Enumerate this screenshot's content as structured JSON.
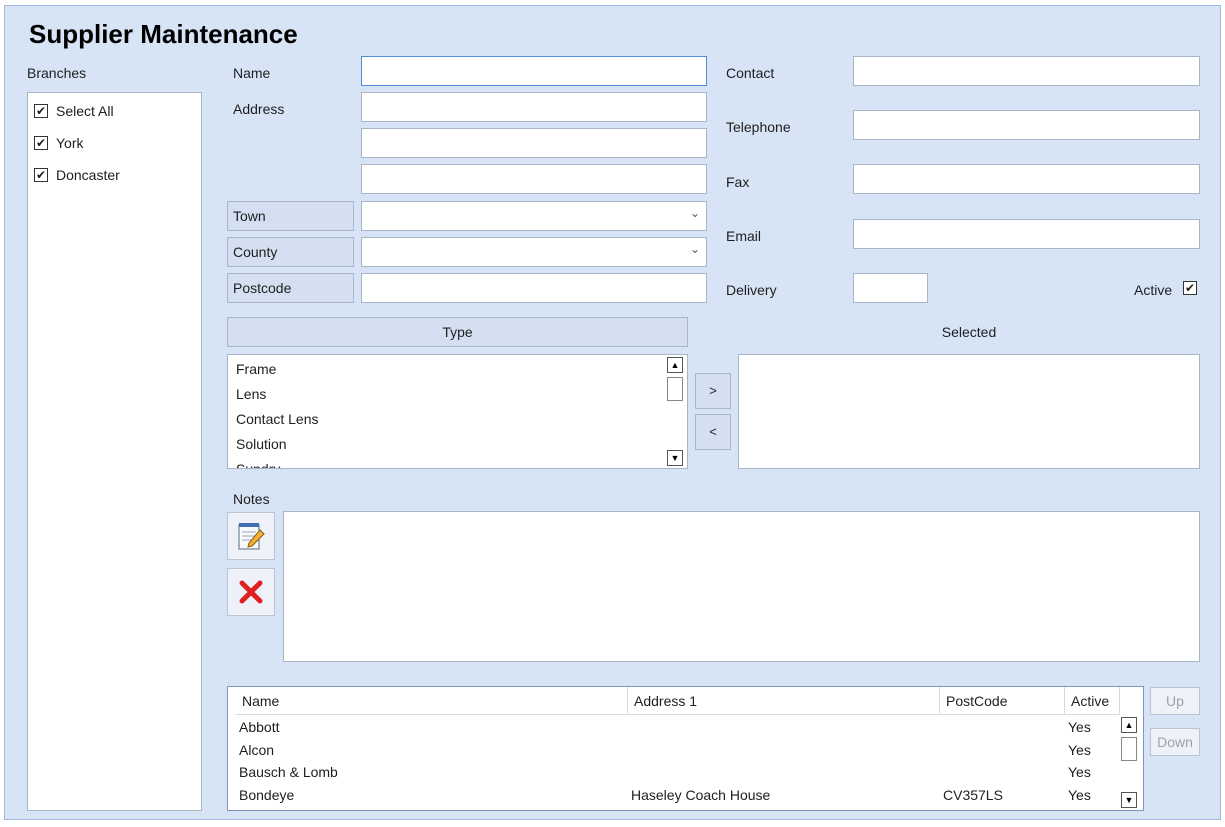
{
  "window": {
    "title": "Supplier Maintenance"
  },
  "branches": {
    "label": "Branches",
    "items": [
      {
        "label": "Select All",
        "checked": true
      },
      {
        "label": "York",
        "checked": true
      },
      {
        "label": "Doncaster",
        "checked": true
      }
    ]
  },
  "form": {
    "name_label": "Name",
    "name_value": "",
    "address_label": "Address",
    "address_lines": [
      "",
      "",
      ""
    ],
    "town_label": "Town",
    "town_value": "",
    "county_label": "County",
    "county_value": "",
    "postcode_label": "Postcode",
    "postcode_value": "",
    "contact_label": "Contact",
    "contact_value": "",
    "telephone_label": "Telephone",
    "telephone_value": "",
    "fax_label": "Fax",
    "fax_value": "",
    "email_label": "Email",
    "email_value": "",
    "delivery_label": "Delivery",
    "delivery_value": "",
    "active_label": "Active",
    "active_checked": true
  },
  "type_list": {
    "header": "Type",
    "items": [
      "Frame",
      "Lens",
      "Contact Lens",
      "Solution",
      "Sundry"
    ]
  },
  "selected_list": {
    "header": "Selected",
    "items": []
  },
  "move_buttons": {
    "add": ">",
    "remove": "<"
  },
  "notes": {
    "label": "Notes",
    "value": "",
    "edit_icon": "notepad-edit-icon",
    "delete_icon": "red-x-delete-icon"
  },
  "grid": {
    "columns": [
      "Name",
      "Address 1",
      "PostCode",
      "Active"
    ],
    "rows": [
      {
        "name": "Abbott",
        "address1": "",
        "postcode": "",
        "active": "Yes"
      },
      {
        "name": "Alcon",
        "address1": "",
        "postcode": "",
        "active": "Yes"
      },
      {
        "name": "Bausch & Lomb",
        "address1": "",
        "postcode": "",
        "active": "Yes"
      },
      {
        "name": "Bondeye",
        "address1": "Haseley Coach House",
        "postcode": "CV357LS",
        "active": "Yes"
      }
    ]
  },
  "side_buttons": {
    "up": "Up",
    "down": "Down"
  },
  "colors": {
    "window_bg": "#d7e4f6",
    "border": "#a9b6c8",
    "delete_red": "#e02020"
  }
}
